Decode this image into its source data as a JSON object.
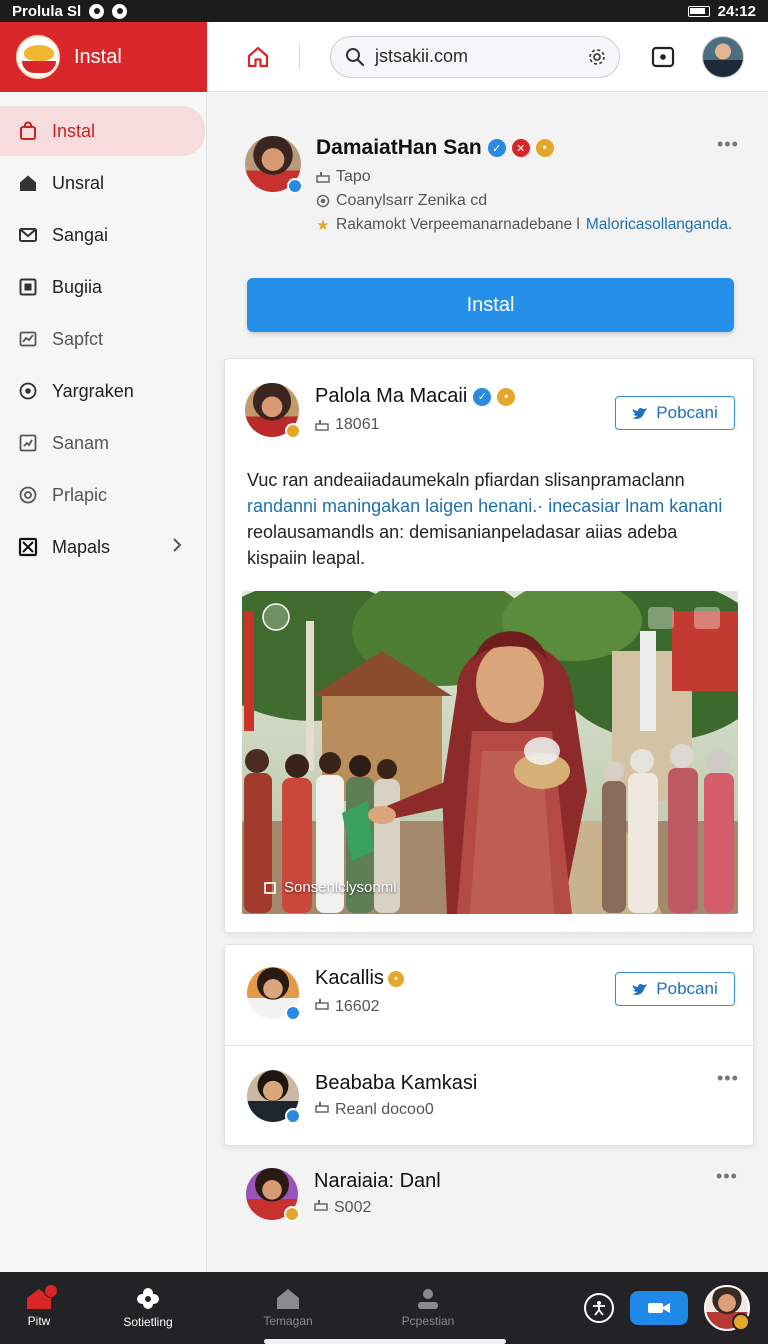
{
  "status_bar": {
    "left_text": "Prolula Sl",
    "time": "24:12"
  },
  "brand": {
    "name": "Instal"
  },
  "search": {
    "value": "jstsakii.com"
  },
  "sidebar": {
    "items": [
      {
        "label": "Instal",
        "icon": "bag-icon"
      },
      {
        "label": "Unsral",
        "icon": "home-icon"
      },
      {
        "label": "Sangai",
        "icon": "mail-icon"
      },
      {
        "label": "Bugiia",
        "icon": "grid-icon"
      },
      {
        "label": "Sapfct",
        "icon": "chart-icon"
      },
      {
        "label": "Yargraken",
        "icon": "target-icon"
      },
      {
        "label": "Sanam",
        "icon": "trend-icon"
      },
      {
        "label": "Prlapic",
        "icon": "pin-icon"
      },
      {
        "label": "Mapals",
        "icon": "box-x-icon"
      }
    ]
  },
  "profile": {
    "name": "DamaiatHan San",
    "line1": "Tapo",
    "line2": "Coanylsarr Zenika cd",
    "line3_prefix": "Rakamokt Verpeemanarnadebane l",
    "line3_link": "Maloricasollanganda."
  },
  "install_button": {
    "label": "Instal"
  },
  "post": {
    "author": "Palola Ma Macaii",
    "meta": "18061",
    "follow_label": "Pobcani",
    "text_1": "Vuc ran andeaiiadaumekaln pfiardan slisanpramaclann",
    "text_2": "randanni maningakan laigen henani.· inecasiar lnam kanani",
    "text_3": "reolausamandls an: demisanianpeladasar aiias adeba kispaiin leapal.",
    "image_caption": "Sonsenlclysonml"
  },
  "list": [
    {
      "name": "Kacallis",
      "meta": "16602",
      "action": "Pobcani"
    },
    {
      "name": "Beababa Kamkasi",
      "meta": "Reanl docoo0",
      "action": "more"
    },
    {
      "name": "Naraiaia: Danl",
      "meta": "S002",
      "action": "more"
    }
  ],
  "bottom_nav": {
    "items": [
      {
        "label": "Pitw"
      },
      {
        "label": "Sotietling"
      },
      {
        "label": "Temagan"
      },
      {
        "label": "Pcpestian"
      }
    ]
  },
  "colors": {
    "brand_red": "#d92628",
    "primary_blue": "#2490ea",
    "link_blue": "#1e6fae"
  }
}
